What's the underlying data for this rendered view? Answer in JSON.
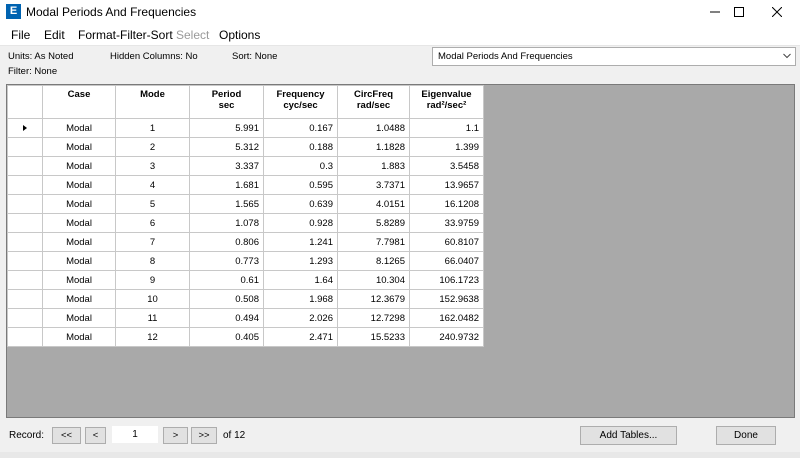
{
  "window": {
    "app_icon_letter": "E",
    "title": "Modal Periods And Frequencies",
    "controls": [
      "minimize-icon",
      "maximize-icon",
      "close-icon"
    ]
  },
  "menu": {
    "items": [
      {
        "label": "File",
        "enabled": true
      },
      {
        "label": "Edit",
        "enabled": true
      },
      {
        "label": "Format-Filter-Sort",
        "enabled": true
      },
      {
        "label": "Select",
        "enabled": false
      },
      {
        "label": "Options",
        "enabled": true
      }
    ]
  },
  "info": {
    "units": "Units:  As Noted",
    "hidden_columns": "Hidden Columns:  No",
    "sort": "Sort:  None",
    "filter": "Filter:  None"
  },
  "table_selector": {
    "value": "Modal Periods And Frequencies",
    "icon": "chevron-down-icon"
  },
  "table": {
    "headers": [
      {
        "line1": "Case",
        "line2": ""
      },
      {
        "line1": "Mode",
        "line2": ""
      },
      {
        "line1": "Period",
        "line2": "sec"
      },
      {
        "line1": "Frequency",
        "line2": "cyc/sec"
      },
      {
        "line1": "CircFreq",
        "line2": "rad/sec"
      },
      {
        "line1": "Eigenvalue",
        "line2": "rad²/sec²"
      }
    ],
    "current_row_indicator": "row-pointer-icon",
    "rows": [
      {
        "case": "Modal",
        "mode": "1",
        "period": "5.991",
        "frequency": "0.167",
        "circfreq": "1.0488",
        "eigenvalue": "1.1"
      },
      {
        "case": "Modal",
        "mode": "2",
        "period": "5.312",
        "frequency": "0.188",
        "circfreq": "1.1828",
        "eigenvalue": "1.399"
      },
      {
        "case": "Modal",
        "mode": "3",
        "period": "3.337",
        "frequency": "0.3",
        "circfreq": "1.883",
        "eigenvalue": "3.5458"
      },
      {
        "case": "Modal",
        "mode": "4",
        "period": "1.681",
        "frequency": "0.595",
        "circfreq": "3.7371",
        "eigenvalue": "13.9657"
      },
      {
        "case": "Modal",
        "mode": "5",
        "period": "1.565",
        "frequency": "0.639",
        "circfreq": "4.0151",
        "eigenvalue": "16.1208"
      },
      {
        "case": "Modal",
        "mode": "6",
        "period": "1.078",
        "frequency": "0.928",
        "circfreq": "5.8289",
        "eigenvalue": "33.9759"
      },
      {
        "case": "Modal",
        "mode": "7",
        "period": "0.806",
        "frequency": "1.241",
        "circfreq": "7.7981",
        "eigenvalue": "60.8107"
      },
      {
        "case": "Modal",
        "mode": "8",
        "period": "0.773",
        "frequency": "1.293",
        "circfreq": "8.1265",
        "eigenvalue": "66.0407"
      },
      {
        "case": "Modal",
        "mode": "9",
        "period": "0.61",
        "frequency": "1.64",
        "circfreq": "10.304",
        "eigenvalue": "106.1723"
      },
      {
        "case": "Modal",
        "mode": "10",
        "period": "0.508",
        "frequency": "1.968",
        "circfreq": "12.3679",
        "eigenvalue": "152.9638"
      },
      {
        "case": "Modal",
        "mode": "11",
        "period": "0.494",
        "frequency": "2.026",
        "circfreq": "12.7298",
        "eigenvalue": "162.0482"
      },
      {
        "case": "Modal",
        "mode": "12",
        "period": "0.405",
        "frequency": "2.471",
        "circfreq": "15.5233",
        "eigenvalue": "240.9732"
      }
    ]
  },
  "footer": {
    "record_label": "Record:",
    "first_label": "<<",
    "prev_label": "<",
    "record_value": "1",
    "next_label": ">",
    "last_label": ">>",
    "of_label": "of 12",
    "add_tables_label": "Add Tables...",
    "done_label": "Done"
  },
  "colors": {
    "app_icon": "#0063b1",
    "grid_background": "#a9a9a9",
    "window": "#f0f0f0"
  }
}
